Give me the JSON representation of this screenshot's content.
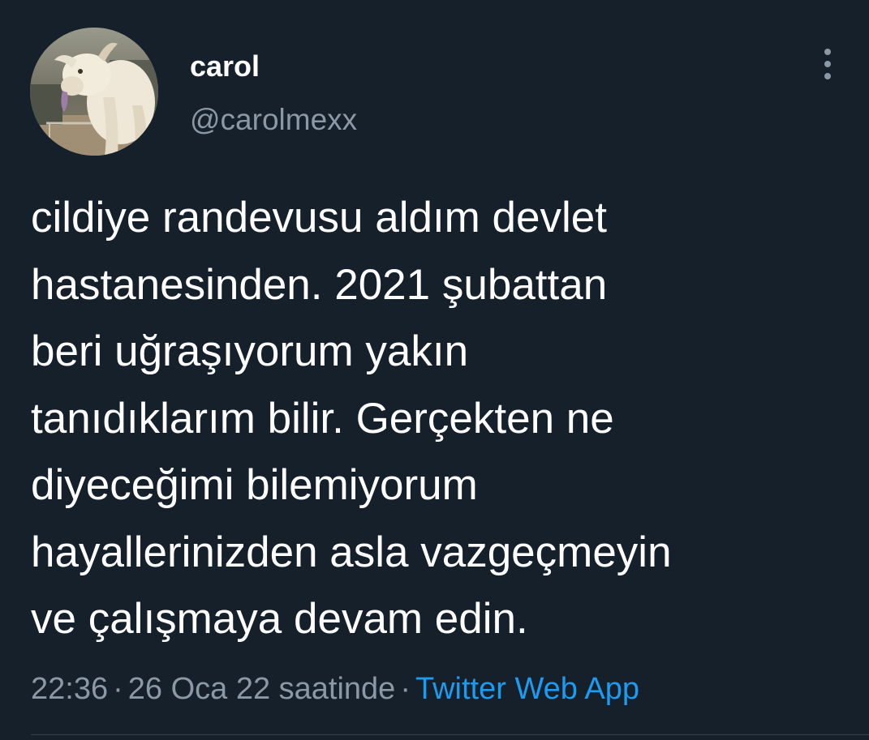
{
  "tweet": {
    "author": {
      "display_name": "carol",
      "handle": "@carolmexx"
    },
    "avatar_icon": "goat-photo-avatar",
    "more_icon": "more-vertical-icon",
    "text_lines": [
      "cildiye randevusu aldım devlet",
      "hastanesinden. 2021 şubattan",
      "beri uğraşıyorum yakın",
      "tanıdıklarım bilir. Gerçekten ne",
      "diyeceğimi bilemiyorum",
      "hayallerinizden asla vazgeçmeyin",
      "ve çalışmaya devam edin."
    ],
    "meta": {
      "time": "22:36",
      "separator": "·",
      "date": "26 Oca 22 saatinde",
      "source": "Twitter Web App"
    }
  },
  "colors": {
    "background": "#15202b",
    "primary_text": "#ffffff",
    "secondary_text": "#8b98a5",
    "link": "#1d9bf0",
    "divider": "#38444d"
  }
}
